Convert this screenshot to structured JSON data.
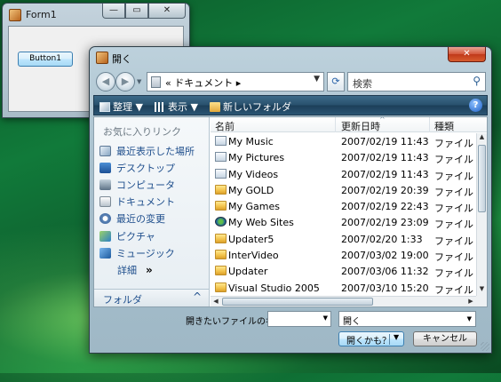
{
  "form1": {
    "title": "Form1",
    "caption": {
      "min": "—",
      "max": "▭",
      "close": "✕"
    },
    "button1_label": "Button1"
  },
  "dialog": {
    "title": "開く",
    "caption_close": "✕",
    "nav": {
      "back": "◀",
      "forward": "▶",
      "history": "▼"
    },
    "address": {
      "path": "« ドキュメント ▸",
      "dropdown": "▼"
    },
    "refresh": "⟳",
    "search": {
      "placeholder": "検索",
      "icon": "⚲"
    },
    "toolbar": {
      "organize": "整理 ▼",
      "views": "表示 ▼",
      "new_folder": "新しいフォルダ",
      "help": "?"
    },
    "navpane": {
      "favorites_title": "お気に入りリンク",
      "items": [
        {
          "label": "最近表示した場所",
          "icon": "recent-places-icon"
        },
        {
          "label": "デスクトップ",
          "icon": "desktop-icon"
        },
        {
          "label": "コンピュータ",
          "icon": "computer-icon"
        },
        {
          "label": "ドキュメント",
          "icon": "documents-icon"
        },
        {
          "label": "最近の変更",
          "icon": "recently-changed-icon"
        },
        {
          "label": "ピクチャ",
          "icon": "pictures-icon"
        },
        {
          "label": "ミュージック",
          "icon": "music-icon"
        }
      ],
      "more_label": "詳細",
      "more_chevron": "»",
      "folders_label": "フォルダ",
      "folders_caret": "^"
    },
    "columns": {
      "name": "名前",
      "date": "更新日時",
      "type": "種類",
      "sort_arrow": "^"
    },
    "files": [
      {
        "name": "My Music",
        "date": "2007/02/19 11:43",
        "type": "ファイル フ",
        "icon": "shortcut"
      },
      {
        "name": "My Pictures",
        "date": "2007/02/19 11:43",
        "type": "ファイル フ",
        "icon": "shortcut"
      },
      {
        "name": "My Videos",
        "date": "2007/02/19 11:43",
        "type": "ファイル フ",
        "icon": "shortcut"
      },
      {
        "name": "My GOLD",
        "date": "2007/02/19 20:39",
        "type": "ファイル フ",
        "icon": "folder"
      },
      {
        "name": "My Games",
        "date": "2007/02/19 22:43",
        "type": "ファイル フ",
        "icon": "folder"
      },
      {
        "name": "My Web Sites",
        "date": "2007/02/19 23:09",
        "type": "ファイル フ",
        "icon": "web"
      },
      {
        "name": "Updater5",
        "date": "2007/02/20 1:33",
        "type": "ファイル フ",
        "icon": "folder"
      },
      {
        "name": "InterVideo",
        "date": "2007/03/02 19:00",
        "type": "ファイル フ",
        "icon": "folder"
      },
      {
        "name": "Updater",
        "date": "2007/03/06 11:32",
        "type": "ファイル フ",
        "icon": "folder"
      },
      {
        "name": "Visual Studio 2005",
        "date": "2007/03/10 15:20",
        "type": "ファイル フ",
        "icon": "folder"
      }
    ],
    "filename_label": "開きたいファイルの名前",
    "filename_value": "",
    "filter_value": "開く",
    "open_label": "開くかも？",
    "cancel_label": "キャンセル",
    "dropdown_glyph": "▼"
  }
}
